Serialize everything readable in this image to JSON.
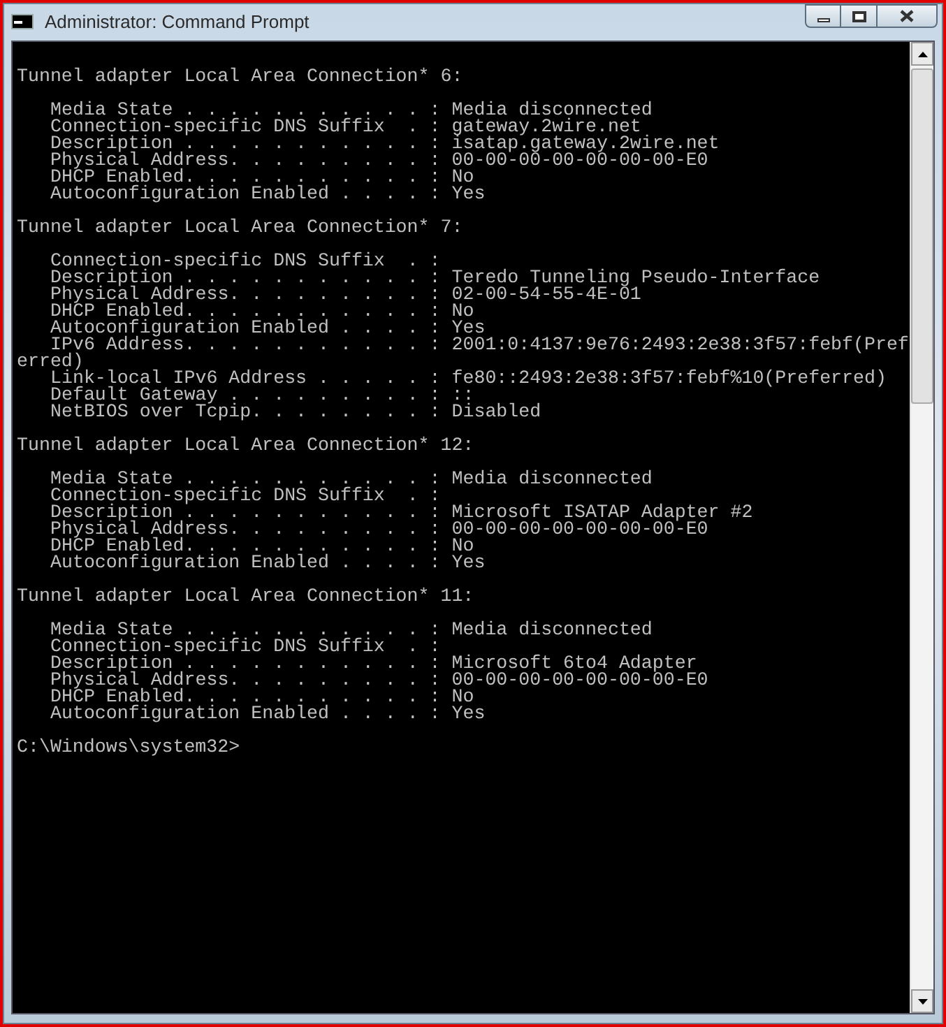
{
  "window": {
    "title": "Administrator: Command Prompt"
  },
  "console": {
    "blocks": [
      {
        "heading": "Tunnel adapter Local Area Connection* 6:",
        "lines": [
          {
            "kind": "entry",
            "text": "Media State . . . . . . . . . . . : Media disconnected"
          },
          {
            "kind": "entry",
            "text": "Connection-specific DNS Suffix  . : gateway.2wire.net"
          },
          {
            "kind": "entry",
            "text": "Description . . . . . . . . . . . : isatap.gateway.2wire.net"
          },
          {
            "kind": "entry",
            "text": "Physical Address. . . . . . . . . : 00-00-00-00-00-00-00-E0"
          },
          {
            "kind": "entry",
            "text": "DHCP Enabled. . . . . . . . . . . : No"
          },
          {
            "kind": "entry",
            "text": "Autoconfiguration Enabled . . . . : Yes"
          }
        ]
      },
      {
        "heading": "Tunnel adapter Local Area Connection* 7:",
        "lines": [
          {
            "kind": "entry",
            "text": "Connection-specific DNS Suffix  . :"
          },
          {
            "kind": "entry",
            "text": "Description . . . . . . . . . . . : Teredo Tunneling Pseudo-Interface"
          },
          {
            "kind": "entry",
            "text": "Physical Address. . . . . . . . . : 02-00-54-55-4E-01"
          },
          {
            "kind": "entry",
            "text": "DHCP Enabled. . . . . . . . . . . : No"
          },
          {
            "kind": "entry",
            "text": "Autoconfiguration Enabled . . . . : Yes"
          },
          {
            "kind": "entry",
            "text": "IPv6 Address. . . . . . . . . . . : 2001:0:4137:9e76:2493:2e38:3f57:febf(Pref"
          },
          {
            "kind": "continuation",
            "text": "erred)"
          },
          {
            "kind": "entry",
            "text": "Link-local IPv6 Address . . . . . : fe80::2493:2e38:3f57:febf%10(Preferred)"
          },
          {
            "kind": "entry",
            "text": "Default Gateway . . . . . . . . . : ::"
          },
          {
            "kind": "entry",
            "text": "NetBIOS over Tcpip. . . . . . . . : Disabled"
          }
        ]
      },
      {
        "heading": "Tunnel adapter Local Area Connection* 12:",
        "lines": [
          {
            "kind": "entry",
            "text": "Media State . . . . . . . . . . . : Media disconnected"
          },
          {
            "kind": "entry",
            "text": "Connection-specific DNS Suffix  . :"
          },
          {
            "kind": "entry",
            "text": "Description . . . . . . . . . . . : Microsoft ISATAP Adapter #2"
          },
          {
            "kind": "entry",
            "text": "Physical Address. . . . . . . . . : 00-00-00-00-00-00-00-E0"
          },
          {
            "kind": "entry",
            "text": "DHCP Enabled. . . . . . . . . . . : No"
          },
          {
            "kind": "entry",
            "text": "Autoconfiguration Enabled . . . . : Yes"
          }
        ]
      },
      {
        "heading": "Tunnel adapter Local Area Connection* 11:",
        "lines": [
          {
            "kind": "entry",
            "text": "Media State . . . . . . . . . . . : Media disconnected"
          },
          {
            "kind": "entry",
            "text": "Connection-specific DNS Suffix  . :"
          },
          {
            "kind": "entry",
            "text": "Description . . . . . . . . . . . : Microsoft 6to4 Adapter"
          },
          {
            "kind": "entry",
            "text": "Physical Address. . . . . . . . . : 00-00-00-00-00-00-00-E0"
          },
          {
            "kind": "entry",
            "text": "DHCP Enabled. . . . . . . . . . . : No"
          },
          {
            "kind": "entry",
            "text": "Autoconfiguration Enabled . . . . : Yes"
          }
        ]
      }
    ],
    "prompt": "C:\\Windows\\system32>"
  }
}
